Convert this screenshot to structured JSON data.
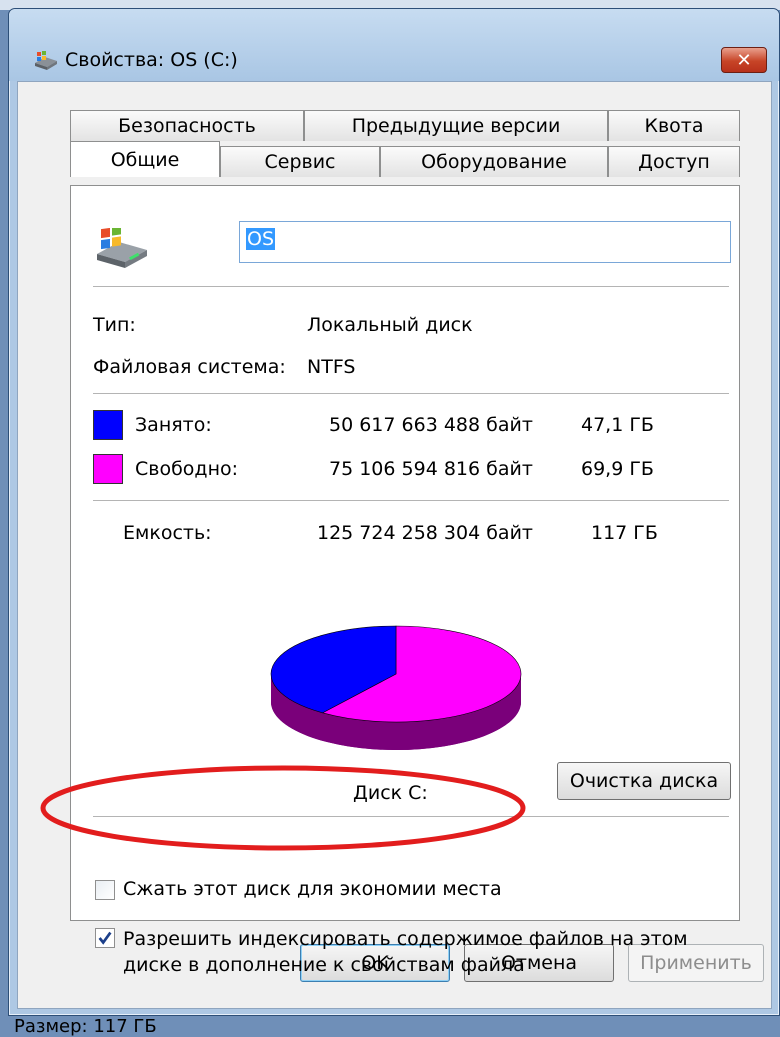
{
  "window": {
    "title": "Свойства: OS (C:)",
    "close_label": "✕"
  },
  "tabs_row1": [
    "Безопасность",
    "Предыдущие версии",
    "Квота"
  ],
  "tabs_row2": [
    "Общие",
    "Сервис",
    "Оборудование",
    "Доступ"
  ],
  "active_tab": "Общие",
  "volume_name": "OS",
  "info": {
    "type_label": "Тип:",
    "type_value": "Локальный диск",
    "fs_label": "Файловая система:",
    "fs_value": "NTFS"
  },
  "usage": {
    "used_label": "Занято:",
    "used_bytes": "50 617 663 488 байт",
    "used_gb": "47,1 ГБ",
    "free_label": "Свободно:",
    "free_bytes": "75 106 594 816 байт",
    "free_gb": "69,9 ГБ",
    "capacity_label": "Емкость:",
    "capacity_bytes": "125 724 258 304 байт",
    "capacity_gb": "117 ГБ",
    "used_color": "#0000ff",
    "free_color": "#ff00ff",
    "used_fraction": 0.4
  },
  "disk_label": "Диск C:",
  "cleanup_button": "Очистка диска",
  "compress_checkbox": {
    "label": "Сжать этот диск для экономии места",
    "checked": false
  },
  "index_checkbox": {
    "label_line1": "Разрешить индексировать содержимое файлов на этом",
    "label_line2": "диске в дополнение к свойствам файла",
    "checked": true
  },
  "buttons": {
    "ok": "OK",
    "cancel": "Отмена",
    "apply": "Применить"
  },
  "backdrop_text": "Размер: 117 ГБ"
}
